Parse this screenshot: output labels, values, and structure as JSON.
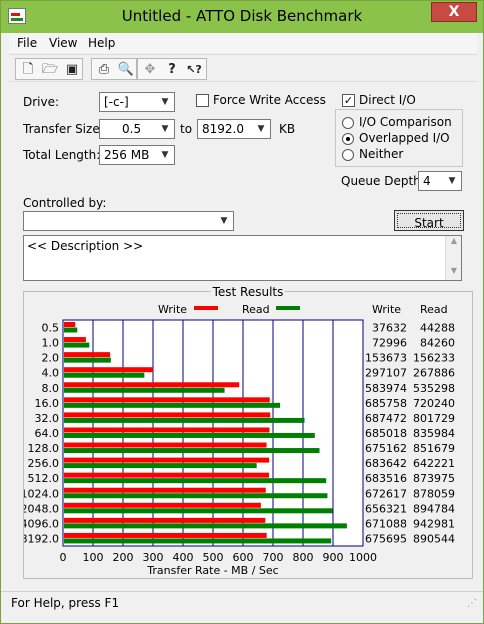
{
  "window": {
    "title": "Untitled - ATTO Disk Benchmark",
    "close": "X"
  },
  "menu": [
    "File",
    "View",
    "Help"
  ],
  "toolbar": {
    "icons": [
      "new-file-icon",
      "open-folder-icon",
      "save-icon",
      "print-icon",
      "print-preview-icon",
      "move-icon",
      "help-icon",
      "context-help-icon"
    ],
    "glyphs": [
      "🗋",
      "🗁",
      "▣",
      "⎙",
      "🔍",
      "✥",
      "?",
      "↖?"
    ]
  },
  "form": {
    "drive_label": "Drive:",
    "drive_value": "[-c-]",
    "force_write_label": "Force Write Access",
    "force_write_checked": false,
    "transfer_size_label": "Transfer Size:",
    "transfer_from": "0.5",
    "to_label": "to",
    "transfer_to": "8192.0",
    "kb_label": "KB",
    "total_length_label": "Total Length:",
    "total_length_value": "256 MB",
    "direct_io_label": "Direct I/O",
    "direct_io_checked": true,
    "io_comparison_label": "I/O Comparison",
    "overlapped_io_label": "Overlapped I/O",
    "neither_label": "Neither",
    "selected_io": "Overlapped I/O",
    "queue_depth_label": "Queue Depth:",
    "queue_depth_value": "4",
    "controlled_by_label": "Controlled by:",
    "controlled_by_value": "",
    "start_label": "Start",
    "description": "<< Description >>"
  },
  "results": {
    "title": "Test Results",
    "write_legend": "Write",
    "read_legend": "Read",
    "write_col": "Write",
    "read_col": "Read",
    "write_color": "#ff0000",
    "read_color": "#008000",
    "rows": [
      {
        "size": "0.5",
        "write": "37632",
        "read": "44288"
      },
      {
        "size": "1.0",
        "write": "72996",
        "read": "84260"
      },
      {
        "size": "2.0",
        "write": "153673",
        "read": "156233"
      },
      {
        "size": "4.0",
        "write": "297107",
        "read": "267886"
      },
      {
        "size": "8.0",
        "write": "583974",
        "read": "535298"
      },
      {
        "size": "16.0",
        "write": "685758",
        "read": "720240"
      },
      {
        "size": "32.0",
        "write": "687472",
        "read": "801729"
      },
      {
        "size": "64.0",
        "write": "685018",
        "read": "835984"
      },
      {
        "size": "128.0",
        "write": "675162",
        "read": "851679"
      },
      {
        "size": "256.0",
        "write": "683642",
        "read": "642221"
      },
      {
        "size": "512.0",
        "write": "683516",
        "read": "873975"
      },
      {
        "size": "1024.0",
        "write": "672617",
        "read": "878059"
      },
      {
        "size": "2048.0",
        "write": "656321",
        "read": "894784"
      },
      {
        "size": "4096.0",
        "write": "671088",
        "read": "942981"
      },
      {
        "size": "8192.0",
        "write": "675695",
        "read": "890544"
      }
    ]
  },
  "chart_data": {
    "type": "bar",
    "orientation": "horizontal",
    "title": "Test Results",
    "xlabel": "Transfer Rate - MB / Sec",
    "xlim": [
      0,
      1000
    ],
    "xticks": [
      "0",
      "100",
      "200",
      "300",
      "400",
      "500",
      "600",
      "700",
      "800",
      "900",
      "1000"
    ],
    "categories": [
      "0.5",
      "1.0",
      "2.0",
      "4.0",
      "8.0",
      "16.0",
      "32.0",
      "64.0",
      "128.0",
      "256.0",
      "512.0",
      "1024.0",
      "2048.0",
      "4096.0",
      "8192.0"
    ],
    "series": [
      {
        "name": "Write",
        "values": [
          37.6,
          73.0,
          153.7,
          297.1,
          584.0,
          685.8,
          687.5,
          685.0,
          675.2,
          683.6,
          683.5,
          672.6,
          656.3,
          671.1,
          675.7
        ]
      },
      {
        "name": "Read",
        "values": [
          44.3,
          84.3,
          156.2,
          267.9,
          535.3,
          720.2,
          801.7,
          836.0,
          851.7,
          642.2,
          874.0,
          878.1,
          894.8,
          943.0,
          890.5
        ]
      }
    ],
    "grid": true,
    "legend": "top"
  },
  "status": {
    "text": "For Help, press F1"
  }
}
